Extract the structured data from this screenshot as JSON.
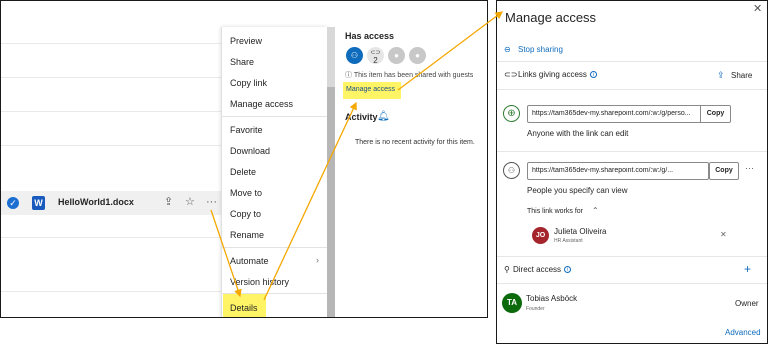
{
  "file_list": {
    "file_name": "HelloWorld1.docx",
    "word_badge": "W"
  },
  "context_menu": {
    "items": [
      "Preview",
      "Share",
      "Copy link",
      "Manage access",
      "Favorite",
      "Download",
      "Delete",
      "Move to",
      "Copy to",
      "Rename",
      "Automate",
      "Version history",
      "Details"
    ]
  },
  "details_pane": {
    "has_access_title": "Has access",
    "avatar_count": "2",
    "shared_note": "This item has been shared with guests",
    "manage_access_link": "Manage access",
    "activity_title": "Activity",
    "activity_text": "There is no recent activity for this item."
  },
  "dialog": {
    "title": "Manage access",
    "stop_sharing": "Stop sharing",
    "links_heading": "Links giving access",
    "share_label": "Share",
    "link1": {
      "url": "https://tam365dev-my.sharepoint.com/:w:/g/perso...",
      "copy_label": "Copy",
      "description": "Anyone with the link can edit"
    },
    "link2": {
      "url": "https://tam365dev-my.sharepoint.com/:w:/g/...",
      "copy_label": "Copy",
      "description": "People you specify can view"
    },
    "link_works_for": "This link works for",
    "person1": {
      "initials": "JO",
      "name": "Julieta Oliveira",
      "role": "HR Assistant",
      "color": "#a4262c"
    },
    "direct_access_heading": "Direct access",
    "person2": {
      "initials": "TA",
      "name": "Tobias Asböck",
      "role": "Founder",
      "permission": "Owner",
      "color": "#0b6a0b"
    },
    "advanced_link": "Advanced"
  },
  "colors": {
    "accent": "#0f6cbd",
    "highlight": "#fff466",
    "arrow": "#f5a800"
  }
}
